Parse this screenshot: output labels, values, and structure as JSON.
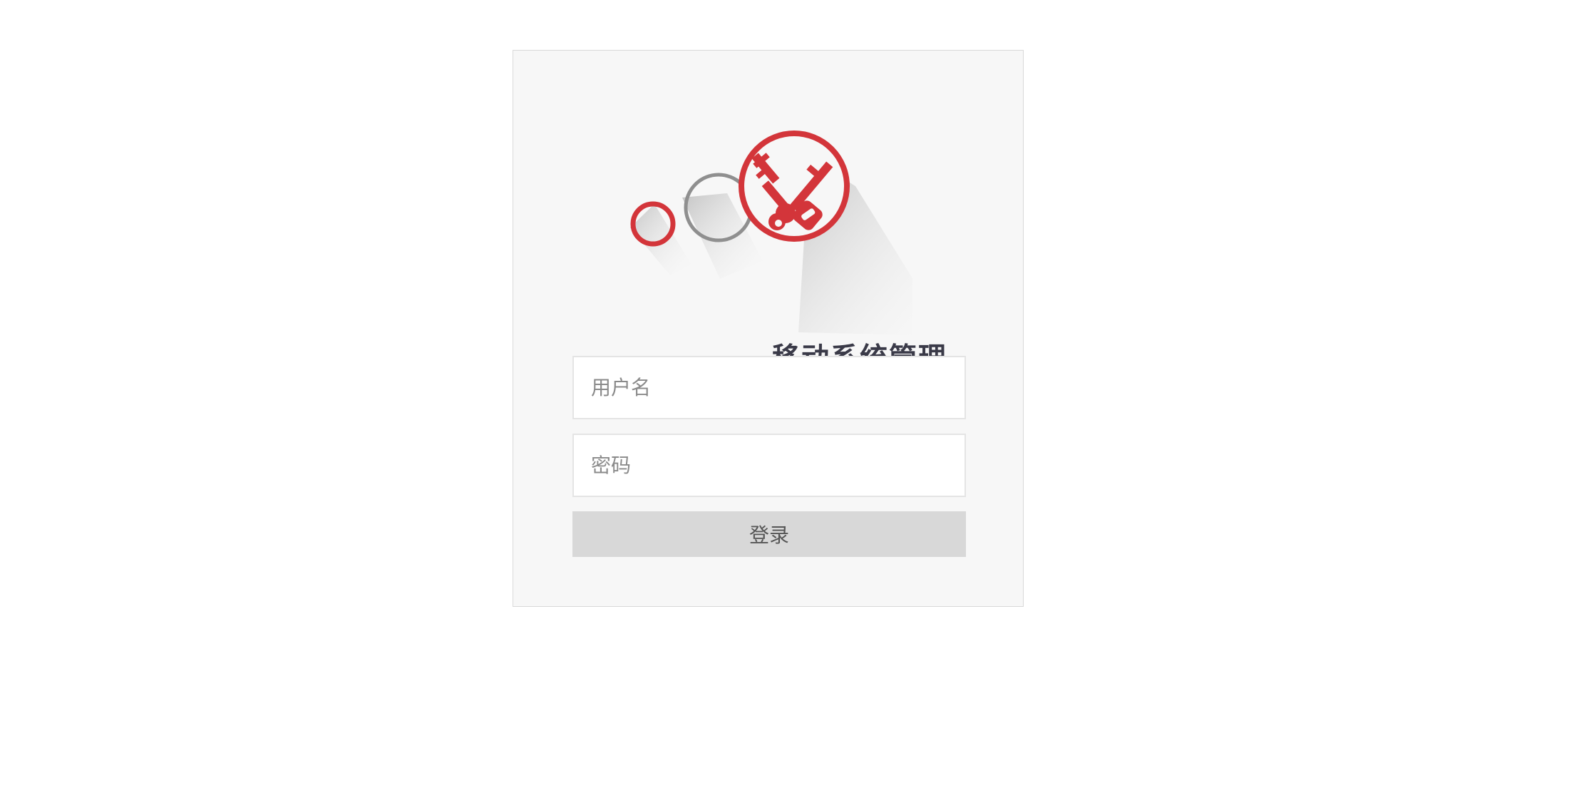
{
  "logo": {
    "caption": "移动系统管理",
    "icon": "crossed-keys-icon",
    "colors": {
      "accent_red": "#d3353a",
      "ring_gray": "#8f8f8f",
      "caption_text": "#3a3a48"
    }
  },
  "form": {
    "username": {
      "placeholder": "用户名",
      "value": ""
    },
    "password": {
      "placeholder": "密码",
      "value": ""
    },
    "submit_label": "登录"
  },
  "colors": {
    "page_background": "#ffffff",
    "card_background": "#f7f7f7",
    "button_background": "#d8d8d8"
  }
}
